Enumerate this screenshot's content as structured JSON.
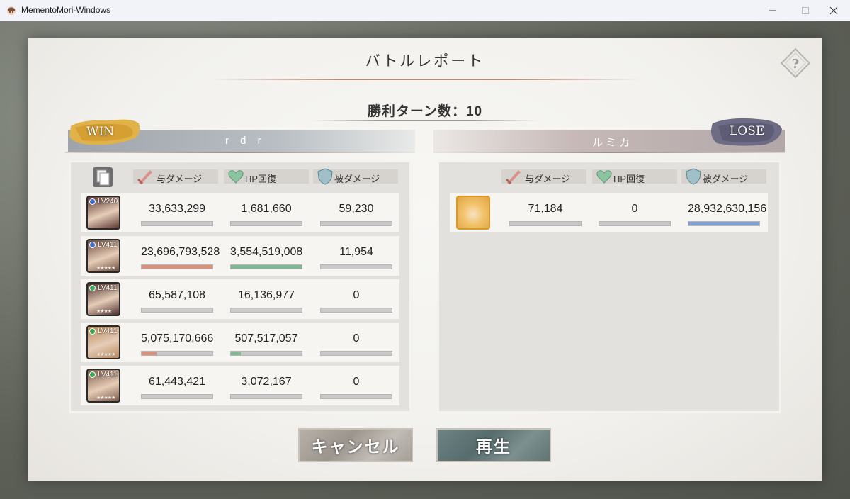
{
  "window": {
    "title": "MementoMori-Windows"
  },
  "report": {
    "title": "バトルレポート",
    "victory_turns": "勝利ターン数：10"
  },
  "left": {
    "result": "WIN",
    "player_name": "r d r",
    "headers": {
      "damage": "与ダメージ",
      "heal": "HP回復",
      "taken": "被ダメージ"
    },
    "characters": [
      {
        "level": "LV240",
        "element": "blue",
        "stars": "",
        "damage": "33,633,299",
        "heal": "1,681,660",
        "taken": "59,230",
        "damage_ratio": 0.0,
        "heal_ratio": 0.0,
        "taken_ratio": 0.0
      },
      {
        "level": "LV411",
        "element": "blue",
        "stars": "★★★★★",
        "damage": "23,696,793,528",
        "heal": "3,554,519,008",
        "taken": "11,954",
        "damage_ratio": 1.0,
        "heal_ratio": 1.0,
        "taken_ratio": 0.0
      },
      {
        "level": "LV411",
        "element": "green",
        "stars": "★★★★",
        "damage": "65,587,108",
        "heal": "16,136,977",
        "taken": "0",
        "damage_ratio": 0.0,
        "heal_ratio": 0.0,
        "taken_ratio": 0.0
      },
      {
        "level": "LV411",
        "element": "green",
        "stars": "★★★★★",
        "damage": "5,075,170,666",
        "heal": "507,517,057",
        "taken": "0",
        "damage_ratio": 0.21,
        "heal_ratio": 0.14,
        "taken_ratio": 0.0
      },
      {
        "level": "LV411",
        "element": "green",
        "stars": "★★★★★",
        "damage": "61,443,421",
        "heal": "3,072,167",
        "taken": "0",
        "damage_ratio": 0.0,
        "heal_ratio": 0.0,
        "taken_ratio": 0.0
      }
    ]
  },
  "right": {
    "result": "LOSE",
    "player_name": "ルミカ",
    "headers": {
      "damage": "与ダメージ",
      "heal": "HP回復",
      "taken": "被ダメージ"
    },
    "characters": [
      {
        "damage": "71,184",
        "heal": "0",
        "taken": "28,932,630,156",
        "damage_ratio": 0.0,
        "heal_ratio": 0.0,
        "taken_ratio": 1.0
      }
    ]
  },
  "buttons": {
    "cancel": "キャンセル",
    "play": "再生"
  },
  "colors": {
    "damage": "#d9917c",
    "heal": "#7fb894",
    "taken": "#7f9fd0",
    "empty": "#c9c9c9"
  },
  "icons": [
    "app-icon",
    "help-icon",
    "list-icon",
    "sword-icon",
    "heart-icon",
    "shield-icon"
  ]
}
